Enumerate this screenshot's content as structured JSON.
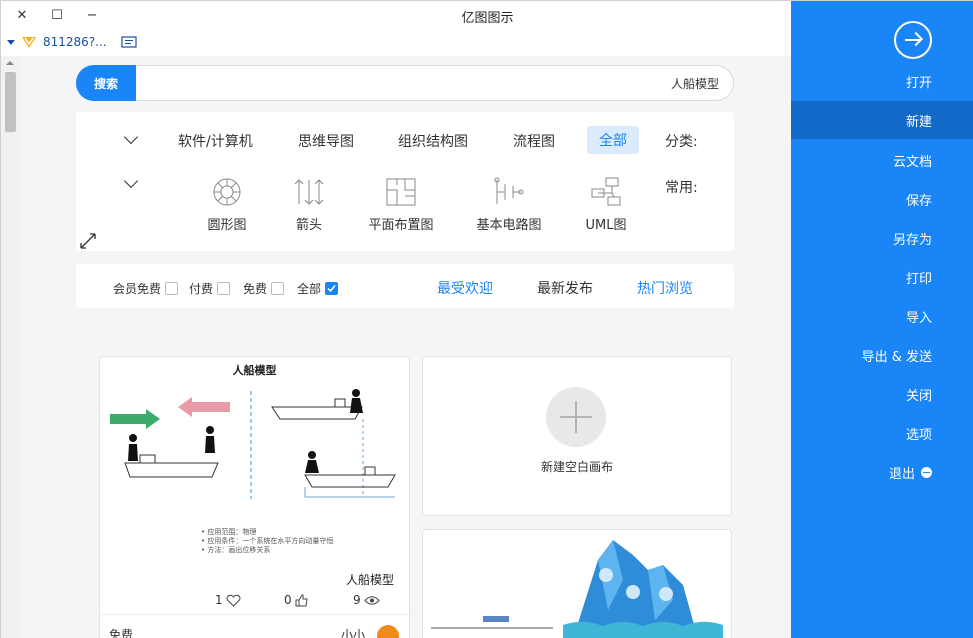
{
  "window": {
    "title": "亿图图示",
    "close_symbol": "✕",
    "maximize_symbol": "☐",
    "minimize_symbol": "−"
  },
  "account": {
    "name": "811286?...",
    "badge_icon": "vip-badge-icon",
    "message_icon": "message-icon"
  },
  "search": {
    "button_label": "搜索",
    "value": "人船模型"
  },
  "category": {
    "label": "分类:",
    "items": [
      "全部",
      "流程图",
      "组织结构图",
      "思维导图",
      "软件/计算机"
    ],
    "active_index": 0
  },
  "common": {
    "label": "常用:",
    "templates": [
      {
        "label": "UML图",
        "icon": "uml-icon"
      },
      {
        "label": "基本电路图",
        "icon": "circuit-icon"
      },
      {
        "label": "平面布置图",
        "icon": "floorplan-icon"
      },
      {
        "label": "箭头",
        "icon": "arrow-icon"
      },
      {
        "label": "圆形图",
        "icon": "circular-icon"
      }
    ]
  },
  "sort": {
    "items": [
      "热门浏览",
      "最新发布",
      "最受欢迎"
    ],
    "active_index": 0,
    "accent_color": "#1a85f6"
  },
  "filters": [
    {
      "label": "全部",
      "checked": true
    },
    {
      "label": "免费",
      "checked": false
    },
    {
      "label": "付费",
      "checked": false
    },
    {
      "label": "会员免费",
      "checked": false
    }
  ],
  "new_blank": {
    "label": "新建空白画布"
  },
  "template_card": {
    "preview_title": "人船模型",
    "preview_caption_1": "• 应用范围：物理",
    "preview_caption_2": "• 应用条件：一个系统在水平方向动量守恒",
    "preview_caption_3": "• 方法：画出位移关系",
    "title": "人船模型",
    "views": "9",
    "likes": "0",
    "favorites": "1",
    "author": "小小",
    "price": "免费"
  },
  "sidebar": {
    "items": [
      "打开",
      "新建",
      "云文档",
      "保存",
      "另存为",
      "打印",
      "导入",
      "导出 & 发送",
      "关闭",
      "选项",
      "退出"
    ],
    "active_index": 1,
    "color": "#1a85f6"
  }
}
